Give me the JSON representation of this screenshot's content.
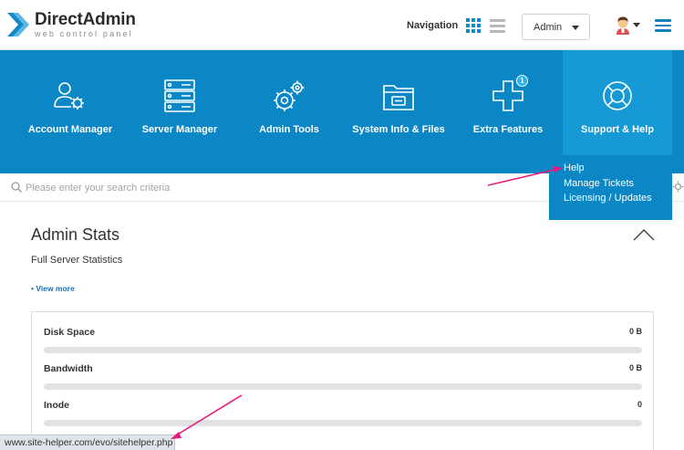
{
  "brand": {
    "name": "DirectAdmin",
    "tagline": "web control panel",
    "accent": "#0a87c4"
  },
  "header": {
    "navigation_label": "Navigation",
    "admin_select": {
      "value": "Admin"
    }
  },
  "menu": {
    "tiles": [
      {
        "label": "Account Manager",
        "icon": "account-manager-icon"
      },
      {
        "label": "Server Manager",
        "icon": "server-icon"
      },
      {
        "label": "Admin Tools",
        "icon": "admin-tools-icon"
      },
      {
        "label": "System Info & Files",
        "icon": "folder-icon"
      },
      {
        "label": "Extra Features",
        "icon": "plus-icon",
        "badge": "1"
      },
      {
        "label": "Support & Help",
        "icon": "lifebuoy-icon",
        "active": true
      }
    ],
    "support_dropdown": [
      "Help",
      "Manage Tickets",
      "Licensing / Updates"
    ]
  },
  "search": {
    "placeholder": "Please enter your search criteria"
  },
  "stats": {
    "title": "Admin Stats",
    "subtitle": "Full Server Statistics",
    "view_more": "• View more",
    "rows": [
      {
        "name": "Disk Space",
        "value": "0 B",
        "fraction": 0
      },
      {
        "name": "Bandwidth",
        "value": "0 B",
        "fraction": 0
      },
      {
        "name": "Inode",
        "value": "0",
        "fraction": 0
      }
    ]
  },
  "statusbar": {
    "url": "www.site-helper.com/evo/sitehelper.php"
  },
  "annotation_color": "#e8197a"
}
